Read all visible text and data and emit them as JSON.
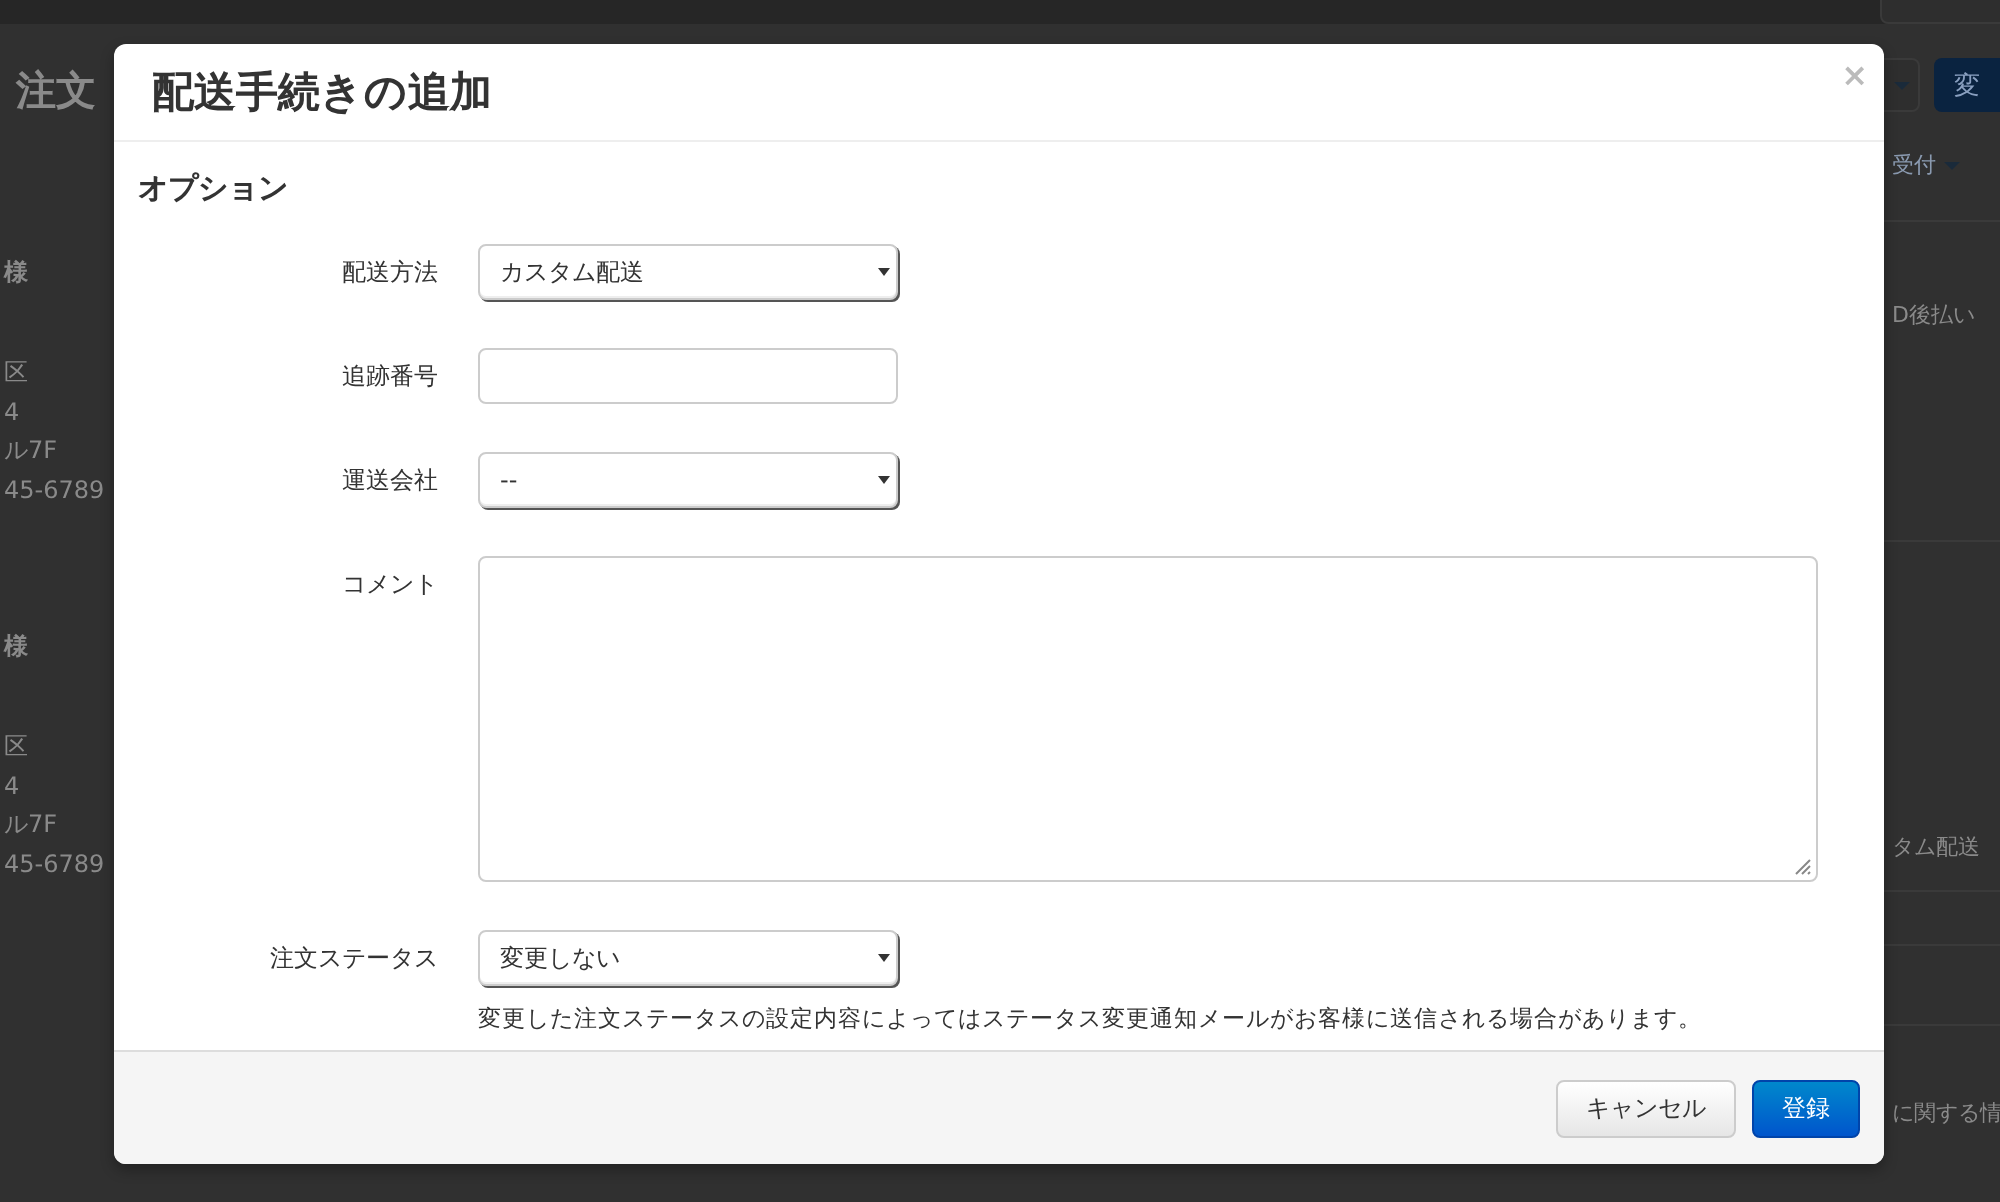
{
  "background": {
    "page_title": "注文",
    "change_button": "変",
    "left_blocks": [
      {
        "name": "様",
        "lines": [
          "区",
          "4",
          "ル7F",
          "45-6789"
        ]
      },
      {
        "name": "様",
        "lines": [
          "区",
          "4",
          "ル7F",
          "45-6789"
        ]
      }
    ],
    "status_menu": "受付",
    "payment": "D後払い",
    "shipping": "タム配送",
    "info_link": "に関する情"
  },
  "dialog": {
    "title": "配送手続きの追加",
    "close": "×",
    "section": "オプション",
    "fields": [
      {
        "kind": "select",
        "label": "配送方法",
        "value": "カスタム配送"
      },
      {
        "kind": "text",
        "label": "追跡番号"
      },
      {
        "kind": "select",
        "label": "運送会社",
        "value": "--"
      },
      {
        "kind": "textarea",
        "label": "コメント"
      },
      {
        "kind": "select",
        "label": "注文ステータス",
        "value": "変更しない",
        "help": "変更した注文ステータスの設定内容によってはステータス変更通知メールがお客様に送信される場合があります。"
      }
    ],
    "buttons": [
      {
        "label": "キャンセル",
        "kind": "default"
      },
      {
        "label": "登録",
        "kind": "primary"
      }
    ]
  }
}
